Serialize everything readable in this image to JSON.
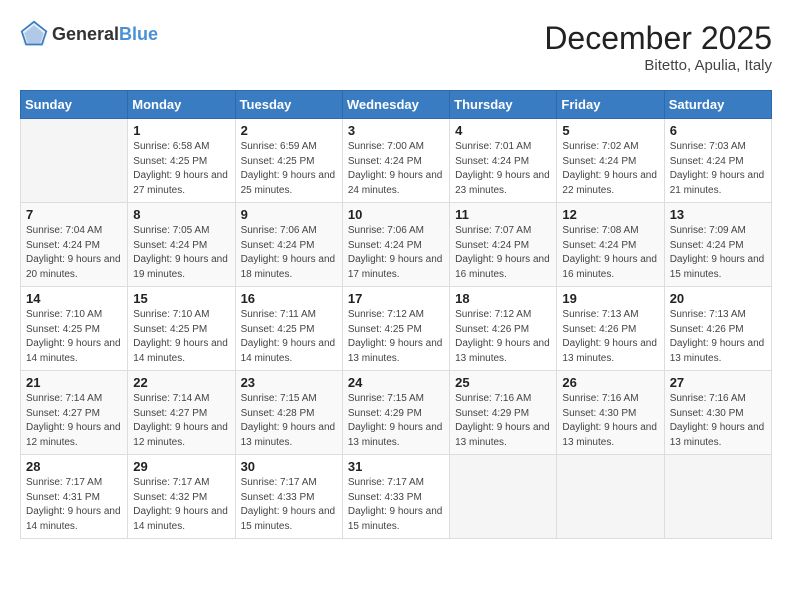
{
  "header": {
    "logo_general": "General",
    "logo_blue": "Blue",
    "month": "December 2025",
    "location": "Bitetto, Apulia, Italy"
  },
  "weekdays": [
    "Sunday",
    "Monday",
    "Tuesday",
    "Wednesday",
    "Thursday",
    "Friday",
    "Saturday"
  ],
  "weeks": [
    [
      {
        "day": "",
        "sunrise": "",
        "sunset": "",
        "daylight": ""
      },
      {
        "day": "1",
        "sunrise": "Sunrise: 6:58 AM",
        "sunset": "Sunset: 4:25 PM",
        "daylight": "Daylight: 9 hours and 27 minutes."
      },
      {
        "day": "2",
        "sunrise": "Sunrise: 6:59 AM",
        "sunset": "Sunset: 4:25 PM",
        "daylight": "Daylight: 9 hours and 25 minutes."
      },
      {
        "day": "3",
        "sunrise": "Sunrise: 7:00 AM",
        "sunset": "Sunset: 4:24 PM",
        "daylight": "Daylight: 9 hours and 24 minutes."
      },
      {
        "day": "4",
        "sunrise": "Sunrise: 7:01 AM",
        "sunset": "Sunset: 4:24 PM",
        "daylight": "Daylight: 9 hours and 23 minutes."
      },
      {
        "day": "5",
        "sunrise": "Sunrise: 7:02 AM",
        "sunset": "Sunset: 4:24 PM",
        "daylight": "Daylight: 9 hours and 22 minutes."
      },
      {
        "day": "6",
        "sunrise": "Sunrise: 7:03 AM",
        "sunset": "Sunset: 4:24 PM",
        "daylight": "Daylight: 9 hours and 21 minutes."
      }
    ],
    [
      {
        "day": "7",
        "sunrise": "Sunrise: 7:04 AM",
        "sunset": "Sunset: 4:24 PM",
        "daylight": "Daylight: 9 hours and 20 minutes."
      },
      {
        "day": "8",
        "sunrise": "Sunrise: 7:05 AM",
        "sunset": "Sunset: 4:24 PM",
        "daylight": "Daylight: 9 hours and 19 minutes."
      },
      {
        "day": "9",
        "sunrise": "Sunrise: 7:06 AM",
        "sunset": "Sunset: 4:24 PM",
        "daylight": "Daylight: 9 hours and 18 minutes."
      },
      {
        "day": "10",
        "sunrise": "Sunrise: 7:06 AM",
        "sunset": "Sunset: 4:24 PM",
        "daylight": "Daylight: 9 hours and 17 minutes."
      },
      {
        "day": "11",
        "sunrise": "Sunrise: 7:07 AM",
        "sunset": "Sunset: 4:24 PM",
        "daylight": "Daylight: 9 hours and 16 minutes."
      },
      {
        "day": "12",
        "sunrise": "Sunrise: 7:08 AM",
        "sunset": "Sunset: 4:24 PM",
        "daylight": "Daylight: 9 hours and 16 minutes."
      },
      {
        "day": "13",
        "sunrise": "Sunrise: 7:09 AM",
        "sunset": "Sunset: 4:24 PM",
        "daylight": "Daylight: 9 hours and 15 minutes."
      }
    ],
    [
      {
        "day": "14",
        "sunrise": "Sunrise: 7:10 AM",
        "sunset": "Sunset: 4:25 PM",
        "daylight": "Daylight: 9 hours and 14 minutes."
      },
      {
        "day": "15",
        "sunrise": "Sunrise: 7:10 AM",
        "sunset": "Sunset: 4:25 PM",
        "daylight": "Daylight: 9 hours and 14 minutes."
      },
      {
        "day": "16",
        "sunrise": "Sunrise: 7:11 AM",
        "sunset": "Sunset: 4:25 PM",
        "daylight": "Daylight: 9 hours and 14 minutes."
      },
      {
        "day": "17",
        "sunrise": "Sunrise: 7:12 AM",
        "sunset": "Sunset: 4:25 PM",
        "daylight": "Daylight: 9 hours and 13 minutes."
      },
      {
        "day": "18",
        "sunrise": "Sunrise: 7:12 AM",
        "sunset": "Sunset: 4:26 PM",
        "daylight": "Daylight: 9 hours and 13 minutes."
      },
      {
        "day": "19",
        "sunrise": "Sunrise: 7:13 AM",
        "sunset": "Sunset: 4:26 PM",
        "daylight": "Daylight: 9 hours and 13 minutes."
      },
      {
        "day": "20",
        "sunrise": "Sunrise: 7:13 AM",
        "sunset": "Sunset: 4:26 PM",
        "daylight": "Daylight: 9 hours and 13 minutes."
      }
    ],
    [
      {
        "day": "21",
        "sunrise": "Sunrise: 7:14 AM",
        "sunset": "Sunset: 4:27 PM",
        "daylight": "Daylight: 9 hours and 12 minutes."
      },
      {
        "day": "22",
        "sunrise": "Sunrise: 7:14 AM",
        "sunset": "Sunset: 4:27 PM",
        "daylight": "Daylight: 9 hours and 12 minutes."
      },
      {
        "day": "23",
        "sunrise": "Sunrise: 7:15 AM",
        "sunset": "Sunset: 4:28 PM",
        "daylight": "Daylight: 9 hours and 13 minutes."
      },
      {
        "day": "24",
        "sunrise": "Sunrise: 7:15 AM",
        "sunset": "Sunset: 4:29 PM",
        "daylight": "Daylight: 9 hours and 13 minutes."
      },
      {
        "day": "25",
        "sunrise": "Sunrise: 7:16 AM",
        "sunset": "Sunset: 4:29 PM",
        "daylight": "Daylight: 9 hours and 13 minutes."
      },
      {
        "day": "26",
        "sunrise": "Sunrise: 7:16 AM",
        "sunset": "Sunset: 4:30 PM",
        "daylight": "Daylight: 9 hours and 13 minutes."
      },
      {
        "day": "27",
        "sunrise": "Sunrise: 7:16 AM",
        "sunset": "Sunset: 4:30 PM",
        "daylight": "Daylight: 9 hours and 13 minutes."
      }
    ],
    [
      {
        "day": "28",
        "sunrise": "Sunrise: 7:17 AM",
        "sunset": "Sunset: 4:31 PM",
        "daylight": "Daylight: 9 hours and 14 minutes."
      },
      {
        "day": "29",
        "sunrise": "Sunrise: 7:17 AM",
        "sunset": "Sunset: 4:32 PM",
        "daylight": "Daylight: 9 hours and 14 minutes."
      },
      {
        "day": "30",
        "sunrise": "Sunrise: 7:17 AM",
        "sunset": "Sunset: 4:33 PM",
        "daylight": "Daylight: 9 hours and 15 minutes."
      },
      {
        "day": "31",
        "sunrise": "Sunrise: 7:17 AM",
        "sunset": "Sunset: 4:33 PM",
        "daylight": "Daylight: 9 hours and 15 minutes."
      },
      {
        "day": "",
        "sunrise": "",
        "sunset": "",
        "daylight": ""
      },
      {
        "day": "",
        "sunrise": "",
        "sunset": "",
        "daylight": ""
      },
      {
        "day": "",
        "sunrise": "",
        "sunset": "",
        "daylight": ""
      }
    ]
  ]
}
